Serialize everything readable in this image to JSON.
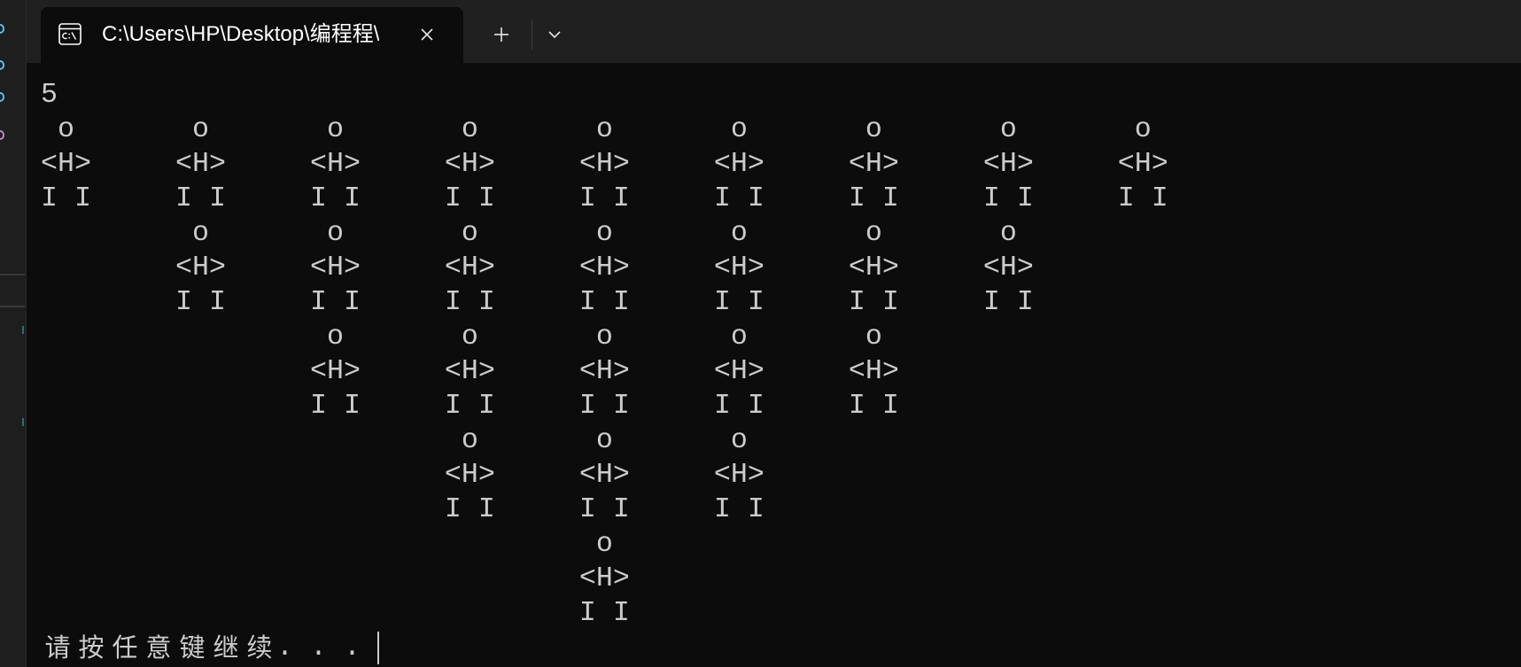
{
  "window": {
    "tab": {
      "icon": "terminal-cmd-icon",
      "title": "C:\\Users\\HP\\Desktop\\编程程\\",
      "close_icon": "close-icon"
    },
    "new_tab_icon": "plus-icon",
    "dropdown_icon": "chevron-down-icon"
  },
  "terminal": {
    "lines": [
      "5",
      " o       o       o       o       o       o       o       o       o",
      "<H>     <H>     <H>     <H>     <H>     <H>     <H>     <H>     <H>",
      "I I     I I     I I     I I     I I     I I     I I     I I     I I",
      "         o       o       o       o       o       o       o",
      "        <H>     <H>     <H>     <H>     <H>     <H>     <H>",
      "        I I     I I     I I     I I     I I     I I     I I",
      "                 o       o       o       o       o",
      "                <H>     <H>     <H>     <H>     <H>",
      "                I I     I I     I I     I I     I I",
      "                         o       o       o",
      "                        <H>     <H>     <H>",
      "                        I I     I I     I I",
      "                                 o",
      "                                <H>",
      "                                I I"
    ],
    "prompt": "请按任意键继续. . ."
  },
  "colors": {
    "terminal_background": "#0c0c0c",
    "terminal_foreground": "#cccccc",
    "tab_bar_background": "#202020",
    "tab_title": "#ffffff"
  }
}
